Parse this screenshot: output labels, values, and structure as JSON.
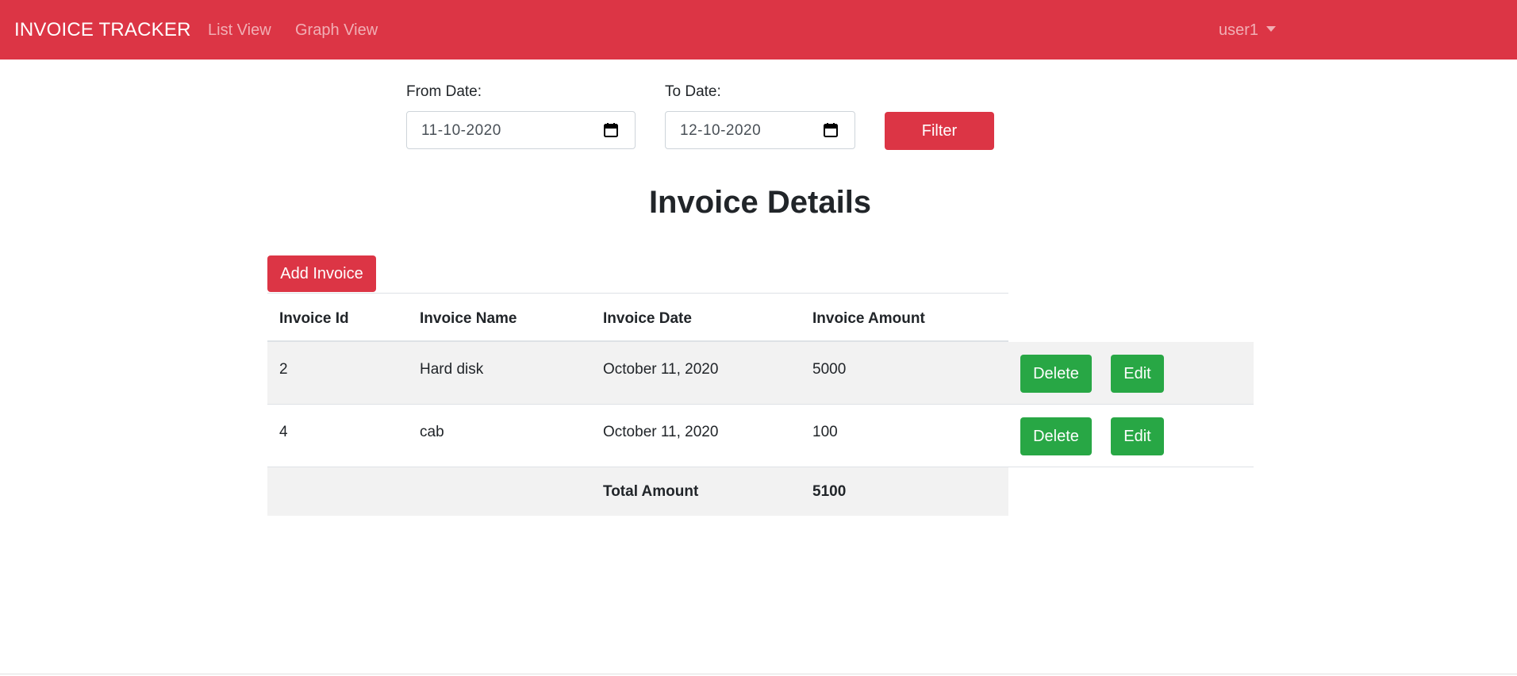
{
  "navbar": {
    "brand": "INVOICE TRACKER",
    "links": [
      "List View",
      "Graph View"
    ],
    "user": "user1",
    "color": "#dc3545"
  },
  "filter": {
    "from_label": "From Date:",
    "from_value": "11-10-2020",
    "to_label": "To Date:",
    "to_value": "12-10-2020",
    "button": "Filter"
  },
  "page": {
    "title": "Invoice Details",
    "add_button": "Add Invoice"
  },
  "table": {
    "headers": [
      "Invoice Id",
      "Invoice Name",
      "Invoice Date",
      "Invoice Amount"
    ],
    "rows": [
      {
        "id": "2",
        "name": "Hard disk",
        "date": "October 11, 2020",
        "amount": "5000",
        "delete": "Delete",
        "edit": "Edit"
      },
      {
        "id": "4",
        "name": "cab",
        "date": "October 11, 2020",
        "amount": "100",
        "delete": "Delete",
        "edit": "Edit"
      }
    ],
    "total_label": "Total Amount",
    "total_value": "5100"
  },
  "colors": {
    "danger": "#dc3545",
    "success": "#28a745",
    "striped_row": "#f2f2f2"
  },
  "icons": {
    "date_picker": "calendar-icon",
    "user_menu": "chevron-down-icon"
  }
}
